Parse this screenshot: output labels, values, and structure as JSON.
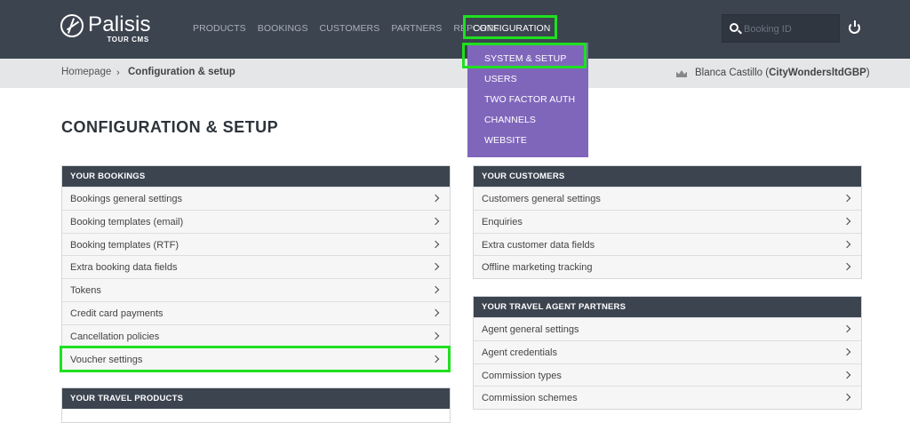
{
  "header": {
    "logo": {
      "name": "Palisis",
      "sub": "TOUR CMS"
    },
    "nav": [
      "PRODUCTS",
      "BOOKINGS",
      "CUSTOMERS",
      "PARTNERS",
      "REPORTS"
    ],
    "nav_active": "CONFIGURATION",
    "search_placeholder": "Booking ID"
  },
  "breadcrumb": {
    "home": "Homepage",
    "separator": "›",
    "current": "Configuration & setup"
  },
  "user": {
    "name": "Blanca Castillo",
    "account": "CityWondersltdGBP"
  },
  "dropdown": [
    "SYSTEM & SETUP",
    "USERS",
    "TWO FACTOR AUTH",
    "CHANNELS",
    "WEBSITE"
  ],
  "page_title": "CONFIGURATION & SETUP",
  "panels": {
    "bookings": {
      "title": "YOUR BOOKINGS",
      "items": [
        "Bookings general settings",
        "Booking templates (email)",
        "Booking templates (RTF)",
        "Extra booking data fields",
        "Tokens",
        "Credit card payments",
        "Cancellation policies",
        "Voucher settings"
      ]
    },
    "travel_products": {
      "title": "YOUR TRAVEL PRODUCTS"
    },
    "customers": {
      "title": "YOUR CUSTOMERS",
      "items": [
        "Customers general settings",
        "Enquiries",
        "Extra customer data fields",
        "Offline marketing tracking"
      ]
    },
    "agents": {
      "title": "YOUR TRAVEL AGENT PARTNERS",
      "items": [
        "Agent general settings",
        "Agent credentials",
        "Commission types",
        "Commission schemes"
      ]
    }
  },
  "colors": {
    "header_bg": "#3c4450",
    "dropdown_bg": "#8066bb",
    "highlight": "#1fe01f",
    "crumb_bg": "#e5e6e8"
  }
}
